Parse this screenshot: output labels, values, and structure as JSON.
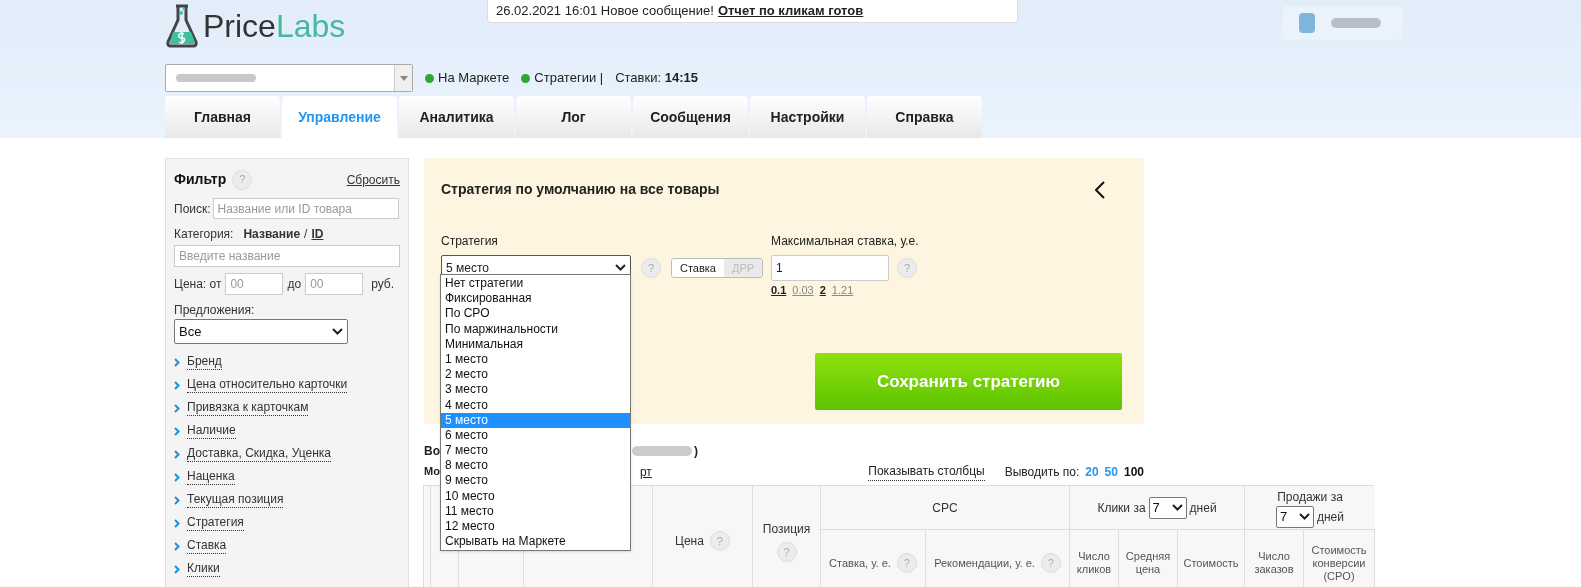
{
  "header": {
    "logo": {
      "part_1": "Price",
      "part_2": "Labs"
    },
    "notification": {
      "text": "26.02.2021 16:01 Новое сообщение!",
      "link": "Отчет по кликам готов"
    },
    "statuses": [
      {
        "label": "На Маркете",
        "color": "#2ea82e"
      },
      {
        "label": "Стратегии |",
        "color": "#2ea82e"
      }
    ],
    "rates": {
      "label": "Ставки:",
      "time": "14:15"
    }
  },
  "tabs": [
    {
      "label": "Главная",
      "selected": false
    },
    {
      "label": "Управление",
      "selected": true
    },
    {
      "label": "Аналитика",
      "selected": false
    },
    {
      "label": "Лог",
      "selected": false
    },
    {
      "label": "Сообщения",
      "selected": false
    },
    {
      "label": "Настройки",
      "selected": false
    },
    {
      "label": "Справка",
      "selected": false
    }
  ],
  "filter": {
    "title": "Фильтр",
    "help": "?",
    "reset": "Сбросить",
    "search": {
      "label": "Поиск:",
      "placeholder": "Название или ID товара"
    },
    "category": {
      "label": "Категория:",
      "by_name": "Название",
      "sep": "/",
      "by_id": "ID",
      "placeholder": "Введите название"
    },
    "price": {
      "label": "Цена: от",
      "from_placeholder": "00",
      "to": "до",
      "to_placeholder": "00",
      "unit": "руб."
    },
    "offers": {
      "label": "Предложения:",
      "value": "Все"
    },
    "sections": [
      "Бренд",
      "Цена относительно карточки",
      "Привязка к карточкам",
      "Наличие",
      "Доставка, Скидка, Уценка",
      "Наценка",
      "Текущая позиция",
      "Стратегия",
      "Ставка",
      "Клики"
    ]
  },
  "strategy_panel": {
    "title": "Стратегия по умолчанию на все товары",
    "strategy_label": "Стратегия",
    "strategy_value": "5 место",
    "help": "?",
    "modes": [
      {
        "label": "Ставка",
        "selected": true
      },
      {
        "label": "ДРР",
        "selected": false
      }
    ],
    "max_bid_label": "Максимальная ставка, у.е.",
    "max_bid_value": "1",
    "max_help": "?",
    "suggestions": [
      {
        "label": "0.1",
        "selected": true
      },
      {
        "label": "0.03",
        "selected": false
      },
      {
        "label": "2",
        "selected": true
      },
      {
        "label": "1.21",
        "selected": false
      }
    ],
    "save": "Сохранить стратегию",
    "options": [
      {
        "label": "Нет стратегии",
        "selected": false
      },
      {
        "label": "Фиксированная",
        "selected": false
      },
      {
        "label": "По CPO",
        "selected": false
      },
      {
        "label": "По маржинальности",
        "selected": false
      },
      {
        "label": "Минимальная",
        "selected": false
      },
      {
        "label": "1 место",
        "selected": false
      },
      {
        "label": "2 место",
        "selected": false
      },
      {
        "label": "3 место",
        "selected": false
      },
      {
        "label": "4 место",
        "selected": false
      },
      {
        "label": "5 место",
        "selected": true
      },
      {
        "label": "6 место",
        "selected": false
      },
      {
        "label": "7 место",
        "selected": false
      },
      {
        "label": "8 место",
        "selected": false
      },
      {
        "label": "9 место",
        "selected": false
      },
      {
        "label": "10 место",
        "selected": false
      },
      {
        "label": "11 место",
        "selected": false
      },
      {
        "label": "12 место",
        "selected": false
      },
      {
        "label": "Скрывать на Маркете",
        "selected": false
      }
    ]
  },
  "products": {
    "heading_start": "Во",
    "heading_end": ")",
    "sub_start": "Мо",
    "sub_link_end": "рт",
    "show_columns": "Показывать столбцы",
    "per_page_label": "Выводить по:",
    "per_page": [
      {
        "label": "20",
        "selected": false
      },
      {
        "label": "50",
        "selected": false
      },
      {
        "label": "100",
        "selected": true
      }
    ],
    "table": {
      "price": "Цена",
      "price_help": "?",
      "position": "Позиция",
      "position_help": "?",
      "sub_help": "?",
      "cpc": "CPC",
      "clicks_label": "Клики за",
      "clicks_days": "7",
      "days": "дней",
      "sales_label": "Продажи за",
      "sales_days": "7",
      "sales_unit": "дней",
      "sub_columns": [
        "Ставка, у. е.",
        "Рекомендации, у. е.",
        "Число кликов",
        "Средняя цена",
        "Стоимость",
        "Число заказов",
        "Стоимость конверсии (CPO)"
      ]
    }
  }
}
